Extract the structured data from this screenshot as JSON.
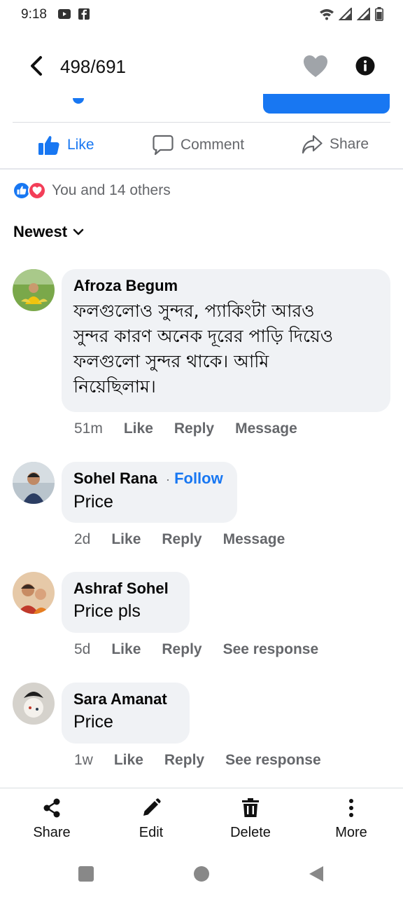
{
  "status_bar": {
    "time": "9:18"
  },
  "topbar": {
    "counter": "498/691"
  },
  "actions": {
    "like": "Like",
    "comment": "Comment",
    "share": "Share"
  },
  "reactions": {
    "text": "You and 14 others"
  },
  "sort": {
    "label": "Newest"
  },
  "comments": [
    {
      "author": "Afroza Begum",
      "lines": [
        "ফলগুলোও সুন্দর, প্যাকিংটা আরও",
        "সুন্দর কারণ  অনেক দূরের পাড়ি দিয়েও",
        "ফলগুলো সুন্দর থাকে। আমি",
        "নিয়েছিলাম।"
      ],
      "time": "51m",
      "like": "Like",
      "reply": "Reply",
      "extra": "Message"
    },
    {
      "author": "Sohel Rana",
      "follow_sep": "·",
      "follow": "Follow",
      "text": "Price",
      "time": "2d",
      "like": "Like",
      "reply": "Reply",
      "extra": "Message"
    },
    {
      "author": "Ashraf Sohel",
      "text": "Price pls",
      "time": "5d",
      "like": "Like",
      "reply": "Reply",
      "extra": "See response"
    },
    {
      "author": "Sara Amanat",
      "text": "Price",
      "time": "1w",
      "like": "Like",
      "reply": "Reply",
      "extra": "See response"
    }
  ],
  "bottom_bar": {
    "share": "Share",
    "edit": "Edit",
    "delete": "Delete",
    "more": "More"
  },
  "colors": {
    "accent": "#1877f2",
    "bubble": "#f0f2f5",
    "muted": "#65676b",
    "love": "#f33e58"
  },
  "icons": [
    "wifi-icon",
    "signal-icon",
    "battery-icon",
    "back-arrow-icon",
    "heart-icon",
    "info-icon",
    "like-thumb-icon",
    "comment-icon",
    "share-arrow-icon",
    "chevron-down-icon",
    "share-nodes-icon",
    "pencil-icon",
    "trash-icon",
    "more-vertical-icon"
  ]
}
